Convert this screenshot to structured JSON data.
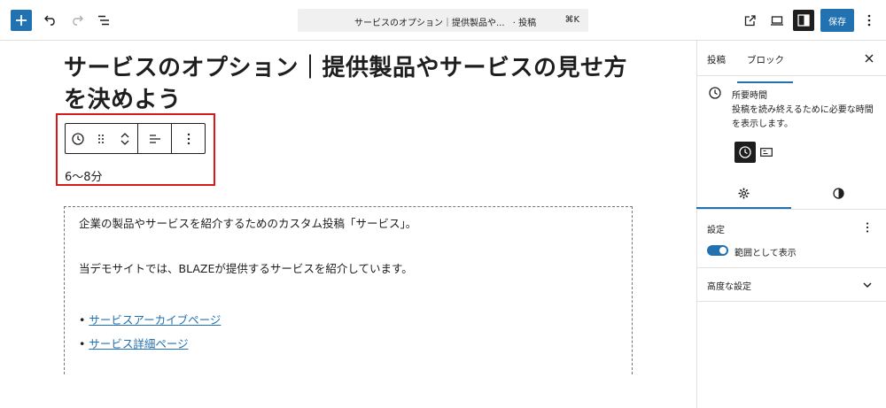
{
  "topbar": {
    "command_title": "サービスのオプション｜提供製品や...",
    "command_type": "· 投稿",
    "command_shortcut": "⌘K",
    "save_label": "保存"
  },
  "post": {
    "title": "サービスのオプション｜提供製品やサービスの見せ方を決めよう",
    "reading_time": "6〜8分",
    "paragraphs": [
      "企業の製品やサービスを紹介するためのカスタム投稿「サービス」。",
      "当デモサイトでは、BLAZEが提供するサービスを紹介しています。"
    ],
    "links": [
      "サービスアーカイブページ",
      "サービス詳細ページ"
    ]
  },
  "sidebar": {
    "tabs": [
      "投稿",
      "ブロック"
    ],
    "active_tab": "ブロック",
    "block_name": "所要時間",
    "block_description": "投稿を読み終えるために必要な時間を表示します。",
    "settings_label": "設定",
    "range_toggle_label": "範囲として表示",
    "range_toggle_on": true,
    "advanced_label": "高度な設定"
  },
  "colors": {
    "accent": "#2271b1",
    "highlight_border": "#d7191c"
  }
}
